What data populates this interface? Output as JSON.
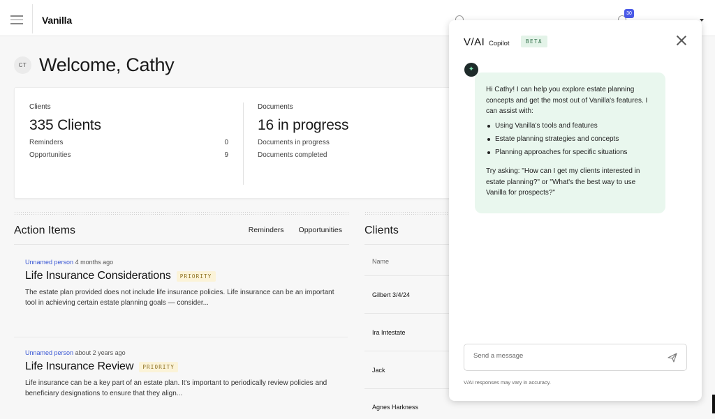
{
  "app": {
    "logo": "Vanilla",
    "notification_count": "30"
  },
  "welcome": {
    "avatar_initials": "CT",
    "title": "Welcome, Cathy"
  },
  "stats": {
    "clients": {
      "label": "Clients",
      "value": "335 Clients",
      "rows": [
        {
          "label": "Reminders",
          "value": "0"
        },
        {
          "label": "Opportunities",
          "value": "9"
        }
      ]
    },
    "documents": {
      "label": "Documents",
      "value": "16 in progress",
      "rows": [
        {
          "label": "Documents in progress",
          "value": ""
        },
        {
          "label": "Documents completed",
          "value": ""
        }
      ]
    }
  },
  "action_items": {
    "title": "Action Items",
    "tabs": [
      {
        "label": "Reminders",
        "active": false
      },
      {
        "label": "Opportunities",
        "active": true
      }
    ],
    "items": [
      {
        "person": "Unnamed person",
        "time": "4 months ago",
        "title": "Life Insurance Considerations",
        "badge": "PRIORITY",
        "description": "The estate plan provided does not include life insurance policies. Life insurance can be an important tool in achieving certain estate planning goals — consider..."
      },
      {
        "person": "Unnamed person",
        "time": "about 2 years ago",
        "title": "Life Insurance Review",
        "badge": "PRIORITY",
        "description": "Life insurance can be a key part of an estate plan. It's important to periodically review policies and beneficiary designations to ensure that they align..."
      }
    ]
  },
  "clients_table": {
    "title": "Clients",
    "column": "Name",
    "rows": [
      "Gilbert 3/4/24",
      "Ira Intestate",
      "Jack",
      "Agnes Harkness"
    ]
  },
  "copilot": {
    "brand": "V/AI",
    "name": "Copilot",
    "badge": "BETA",
    "message": {
      "intro": "Hi Cathy! I can help you explore estate planning concepts and get the most out of Vanilla's features. I can assist with:",
      "bullets": [
        "Using Vanilla's tools and features",
        "Estate planning strategies and concepts",
        "Planning approaches for specific situations"
      ],
      "ask": "Try asking: \"How can I get my clients interested in estate planning?\" or \"What's the best way to use Vanilla for prospects?\""
    },
    "input_placeholder": "Send a message",
    "disclaimer": "V/AI responses may vary in accuracy."
  },
  "colors": {
    "accent": "#4a5ae8",
    "link": "#3b58d4",
    "bubble": "#e9f7ee",
    "priority_bg": "#fbf3d8"
  }
}
